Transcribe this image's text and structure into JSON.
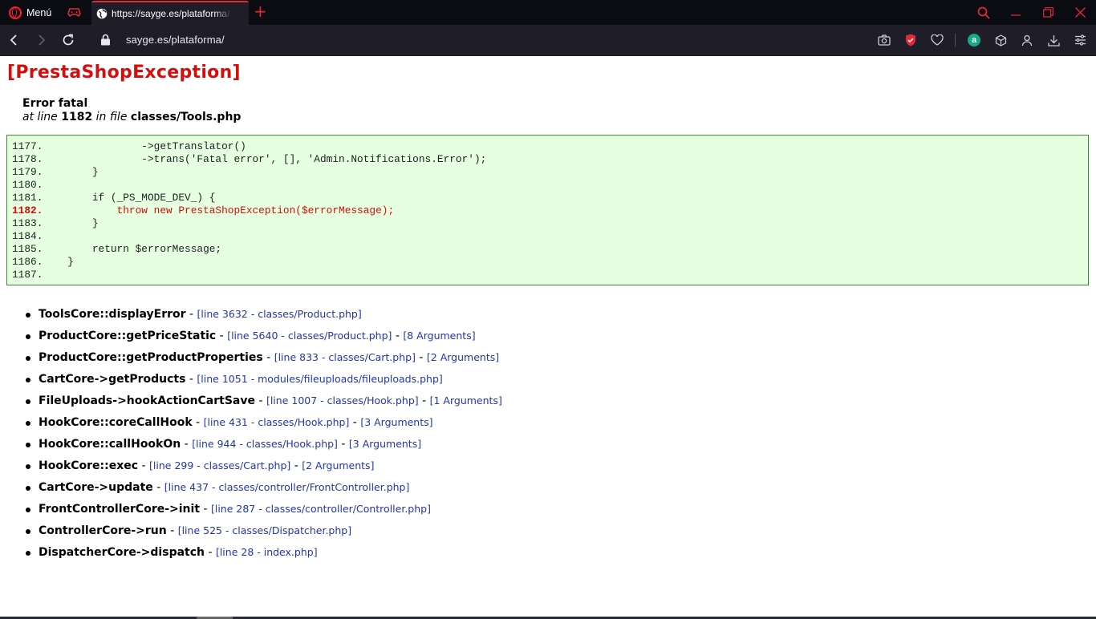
{
  "browser": {
    "menu_label": "Menú",
    "tab_title": "https://sayge.es/plataforma/",
    "url": "sayge.es/plataforma/",
    "accent": "#e02a3b",
    "account_badge_letter": "a",
    "icons": [
      "back-icon",
      "forward-icon",
      "reload-icon",
      "lock-icon",
      "camera-icon",
      "shield-icon",
      "heart-icon",
      "account-icon",
      "cube-icon",
      "person-icon",
      "download-icon",
      "easy-setup-icon",
      "search-icon",
      "minimize-icon",
      "restore-icon",
      "close-icon"
    ]
  },
  "error": {
    "heading": "[PrestaShopException]",
    "title": "Error fatal",
    "at_line_prefix": "at line",
    "line_number": "1182",
    "in_file_prefix": "in file",
    "file": "classes/Tools.php",
    "heading_color": "#d50d0d"
  },
  "code": {
    "lines": [
      {
        "num": "1177.",
        "text": "                ->getTranslator()"
      },
      {
        "num": "1178.",
        "text": "                ->trans('Fatal error', [], 'Admin.Notifications.Error');"
      },
      {
        "num": "1179.",
        "text": "        }"
      },
      {
        "num": "1180.",
        "text": ""
      },
      {
        "num": "1181.",
        "text": "        if (_PS_MODE_DEV_) {"
      },
      {
        "num": "1182.",
        "text": "            throw new PrestaShopException($errorMessage);"
      },
      {
        "num": "1183.",
        "text": "        }"
      },
      {
        "num": "1184.",
        "text": ""
      },
      {
        "num": "1185.",
        "text": "        return $errorMessage;"
      },
      {
        "num": "1186.",
        "text": "    }"
      },
      {
        "num": "1187.",
        "text": ""
      }
    ],
    "highlight_line": "1182."
  },
  "trace": [
    {
      "fn": "ToolsCore::displayError",
      "loc": "[line 3632 - classes/Product.php]",
      "args": ""
    },
    {
      "fn": "ProductCore::getPriceStatic",
      "loc": "[line 5640 - classes/Product.php]",
      "args": "[8 Arguments]"
    },
    {
      "fn": "ProductCore::getProductProperties",
      "loc": "[line 833 - classes/Cart.php]",
      "args": "[2 Arguments]"
    },
    {
      "fn": "CartCore->getProducts",
      "loc": "[line 1051 - modules/fileuploads/fileuploads.php]",
      "args": ""
    },
    {
      "fn": "FileUploads->hookActionCartSave",
      "loc": "[line 1007 - classes/Hook.php]",
      "args": "[1 Arguments]"
    },
    {
      "fn": "HookCore::coreCallHook",
      "loc": "[line 431 - classes/Hook.php]",
      "args": "[3 Arguments]"
    },
    {
      "fn": "HookCore::callHookOn",
      "loc": "[line 944 - classes/Hook.php]",
      "args": "[3 Arguments]"
    },
    {
      "fn": "HookCore::exec",
      "loc": "[line 299 - classes/Cart.php]",
      "args": "[2 Arguments]"
    },
    {
      "fn": "CartCore->update",
      "loc": "[line 437 - classes/controller/FrontController.php]",
      "args": ""
    },
    {
      "fn": "FrontControllerCore->init",
      "loc": "[line 287 - classes/controller/Controller.php]",
      "args": ""
    },
    {
      "fn": "ControllerCore->run",
      "loc": "[line 525 - classes/Dispatcher.php]",
      "args": ""
    },
    {
      "fn": "DispatcherCore->dispatch",
      "loc": "[line 28 - index.php]",
      "args": ""
    }
  ]
}
